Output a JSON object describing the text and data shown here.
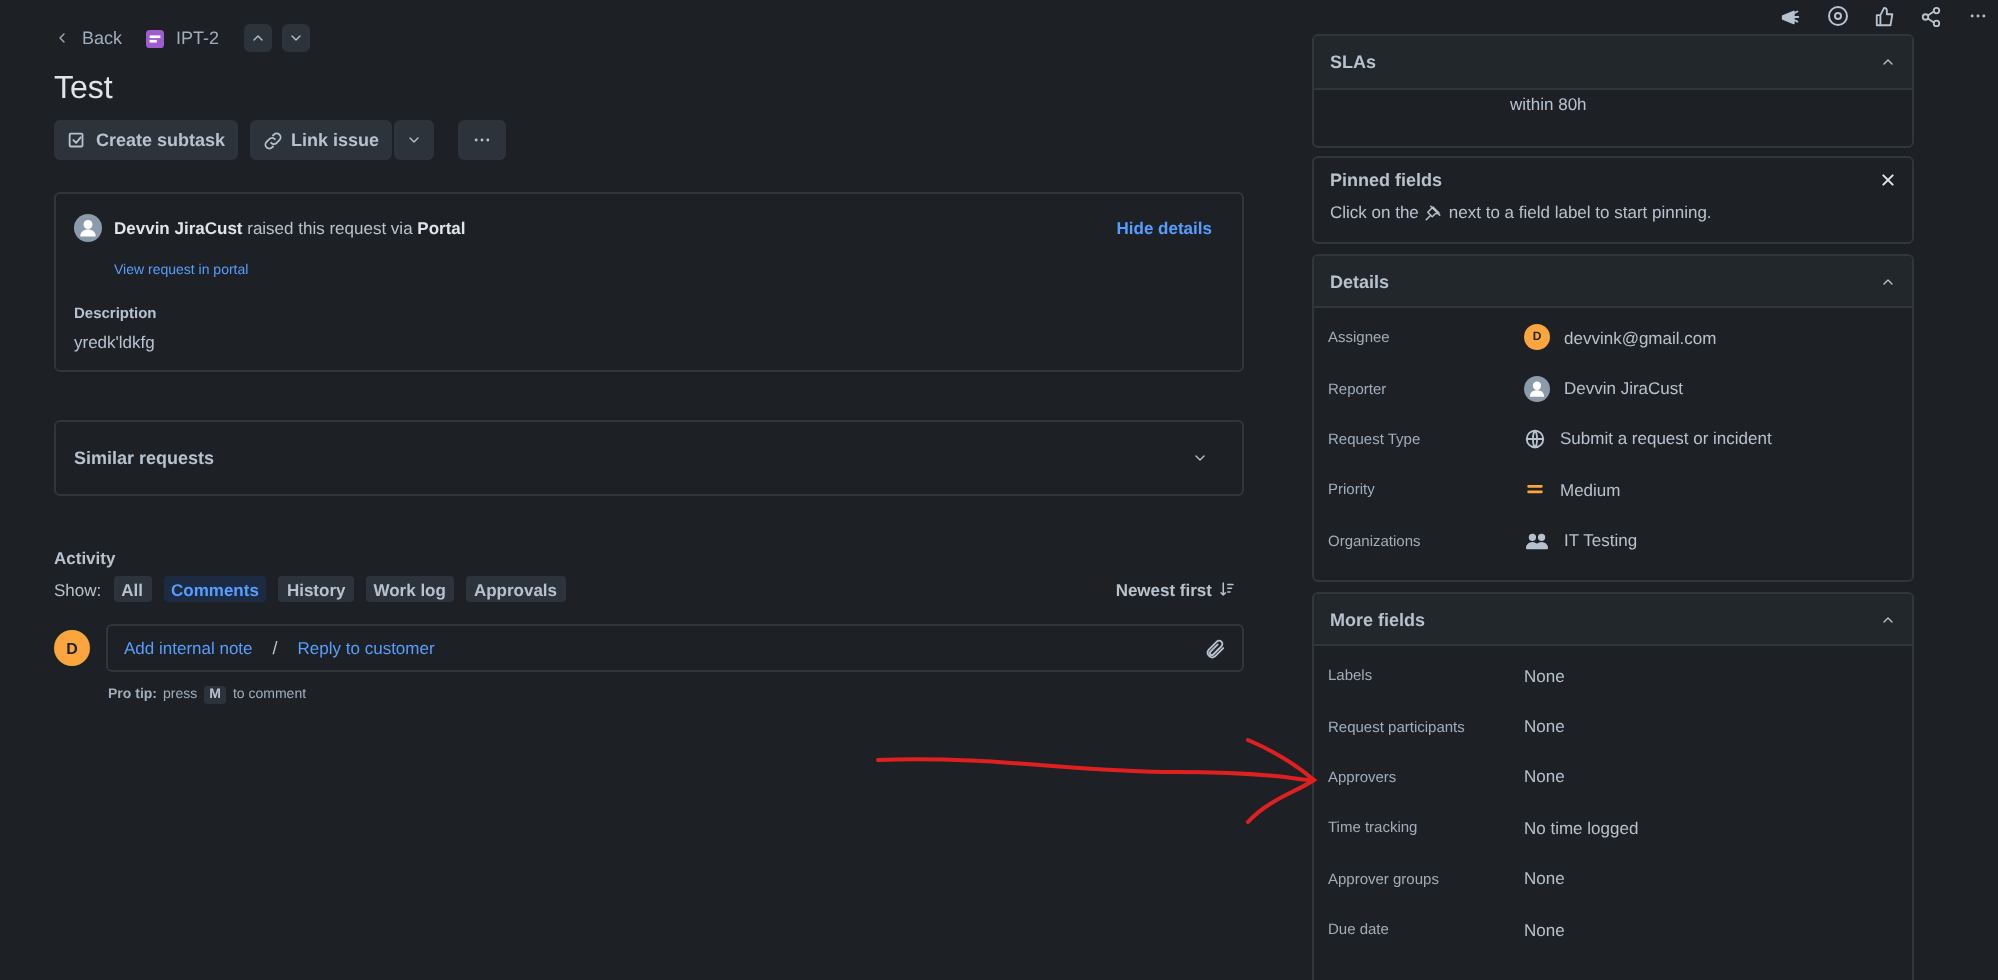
{
  "breadcrumb": {
    "back": "Back",
    "issue_key": "IPT-2"
  },
  "title": "Test",
  "actions": {
    "create_subtask": "Create subtask",
    "link_issue": "Link issue"
  },
  "request": {
    "raised": "**Devvin JiraCust** raised this request via **Portal**",
    "view_link": "View request in portal",
    "hide_details": "Hide details",
    "description_label": "Description",
    "description": "yredk'ldkfg"
  },
  "similar_requests": {
    "title": "Similar requests",
    "expanded": false
  },
  "activity": {
    "title": "Activity",
    "show_label": "Show:",
    "filters": [
      {
        "label": "All",
        "selected": false
      },
      {
        "label": "Comments",
        "selected": true
      },
      {
        "label": "History",
        "selected": false
      },
      {
        "label": "Work log",
        "selected": false
      },
      {
        "label": "Approvals",
        "selected": false
      }
    ],
    "sort": "Newest first"
  },
  "comment": {
    "avatar": "D",
    "add_internal_note": "Add internal note",
    "separator": "/",
    "reply_to_customer": "Reply to customer",
    "tip_label": "Pro tip:",
    "tip_press": "press",
    "tip_key": "M",
    "tip_rest": "to comment"
  },
  "slas": {
    "title": "SLAs",
    "expanded": true,
    "text": "within 80h"
  },
  "pinned": {
    "title": "Pinned fields",
    "hint_start": "Click on the",
    "hint_end": "next to a field label to start pinning."
  },
  "details": {
    "title": "Details",
    "expanded": true,
    "fields": [
      {
        "label": "Assignee",
        "value": "devvink@gmail.com",
        "kind": "letter",
        "avatar": "D"
      },
      {
        "label": "Reporter",
        "value": "Devvin JiraCust",
        "kind": "person"
      },
      {
        "label": "Request Type",
        "value": "Submit a request or incident",
        "kind": "globe"
      },
      {
        "label": "Priority",
        "value": "Medium",
        "kind": "priority"
      },
      {
        "label": "Organizations",
        "value": "IT Testing",
        "kind": "org"
      }
    ]
  },
  "more_fields": {
    "title": "More fields",
    "expanded": true,
    "fields": [
      {
        "label": "Labels",
        "value": "None"
      },
      {
        "label": "Request participants",
        "value": "None"
      },
      {
        "label": "Approvers",
        "value": "None"
      },
      {
        "label": "Time tracking",
        "value": "No time logged"
      },
      {
        "label": "Approver groups",
        "value": "None"
      },
      {
        "label": "Due date",
        "value": "None"
      }
    ]
  }
}
